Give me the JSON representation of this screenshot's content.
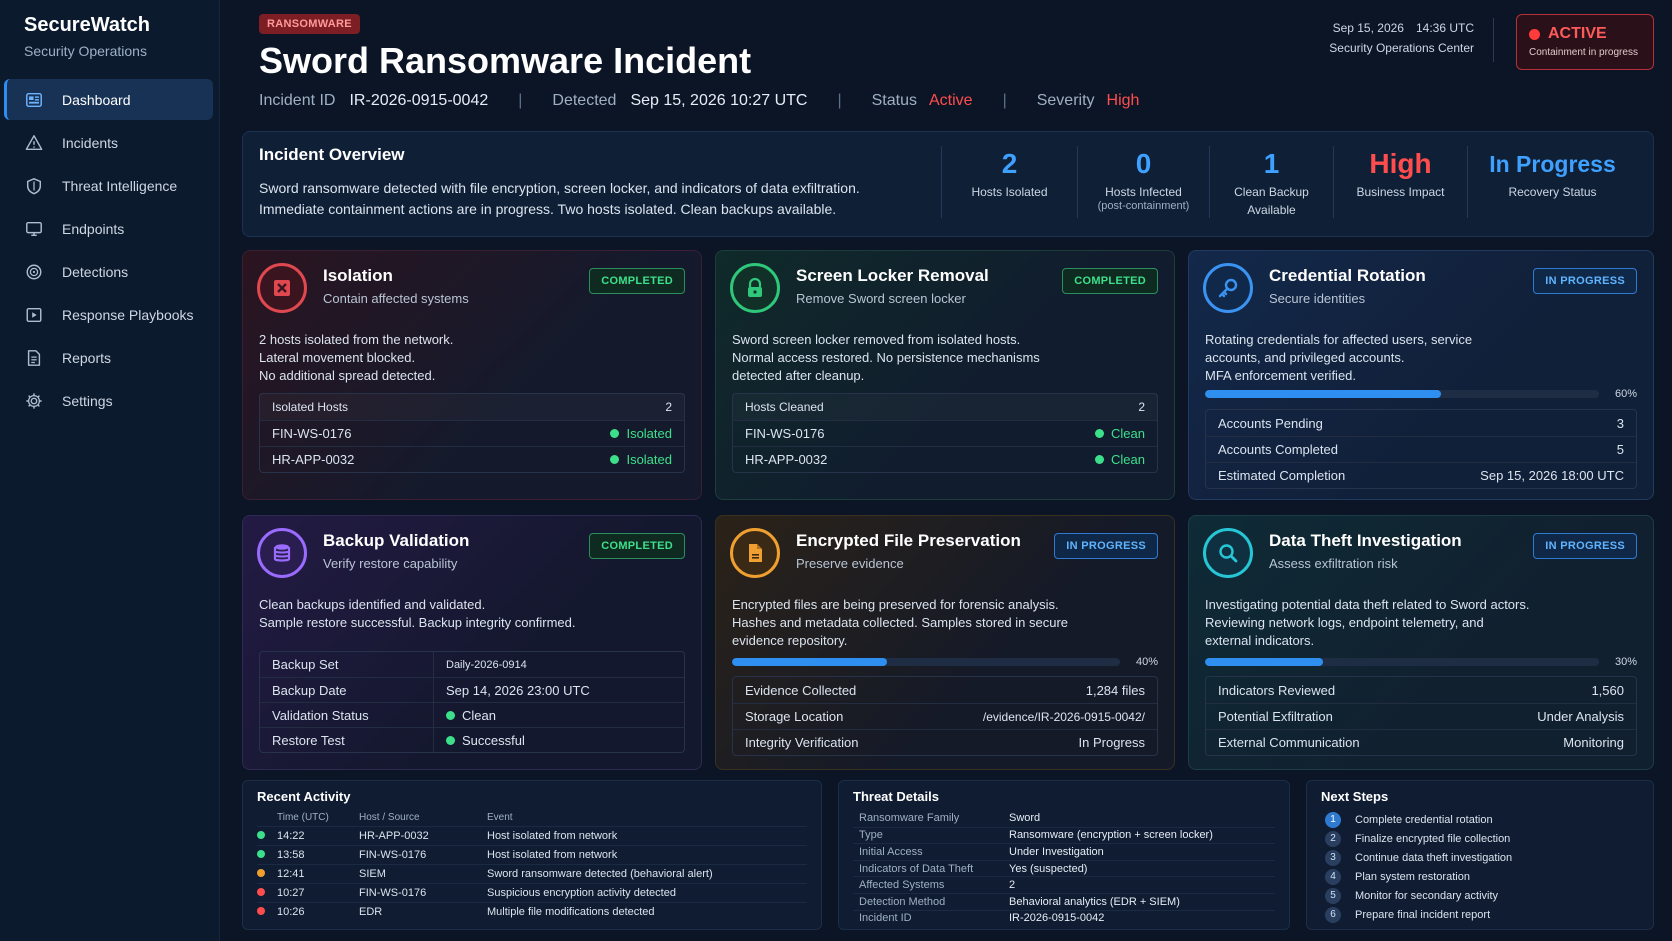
{
  "brand": {
    "title": "SecureWatch",
    "subtitle": "Security Operations"
  },
  "sidebar": {
    "items": [
      {
        "label": "Dashboard",
        "icon": "dashboard-icon",
        "active": true
      },
      {
        "label": "Incidents",
        "icon": "warning-triangle-icon"
      },
      {
        "label": "Threat Intelligence",
        "icon": "shield-icon"
      },
      {
        "label": "Endpoints",
        "icon": "monitor-icon"
      },
      {
        "label": "Detections",
        "icon": "radar-icon"
      },
      {
        "label": "Response Playbooks",
        "icon": "playbook-icon"
      },
      {
        "label": "Reports",
        "icon": "document-icon"
      },
      {
        "label": "Settings",
        "icon": "gear-icon"
      }
    ]
  },
  "header": {
    "tag": "RANSOMWARE",
    "title": "Sword Ransomware Incident",
    "incident_label": "Incident ID",
    "incident_id": "IR-2026-0915-0042",
    "detected_label": "Detected",
    "detected_value": "Sep 15, 2026 10:27 UTC",
    "status_label": "Status",
    "status_value": "Active",
    "severity_label": "Severity",
    "severity_value": "High",
    "date": "Sep 15, 2026",
    "time": "14:36 UTC",
    "center": "Security Operations Center",
    "active_label": "ACTIVE",
    "active_sub": "Containment in progress"
  },
  "colors": {
    "accent": "#2f8cf0",
    "danger": "#ff4d4d",
    "success": "#3de08a"
  },
  "overview": {
    "title": "Incident Overview",
    "description": "Sword ransomware detected with file encryption, screen locker, and indicators of data exfiltration. Immediate containment actions are in progress. Two hosts isolated. Clean backups available.",
    "stats": [
      {
        "value": "2",
        "label": "Hosts Isolated",
        "sub": ""
      },
      {
        "value": "0",
        "label": "Hosts Infected",
        "sub": "(post-containment)"
      },
      {
        "value": "1",
        "label": "Clean Backup",
        "sub": "Available"
      },
      {
        "value": "High",
        "label": "Business Impact",
        "sub": ""
      },
      {
        "value": "In Progress",
        "label": "Recovery Status",
        "sub": ""
      }
    ]
  },
  "cards": {
    "isolation": {
      "title": "Isolation",
      "subtitle": "Contain affected systems",
      "badge": "COMPLETED",
      "desc": [
        "2 hosts isolated from the network.",
        "Lateral movement blocked.",
        "No additional spread detected."
      ],
      "table_head": "Isolated Hosts",
      "table_count": "2",
      "rows": [
        {
          "host": "FIN-WS-0176",
          "status": "Isolated"
        },
        {
          "host": "HR-APP-0032",
          "status": "Isolated"
        }
      ]
    },
    "screen": {
      "title": "Screen Locker Removal",
      "subtitle": "Remove Sword screen locker",
      "badge": "COMPLETED",
      "desc": [
        "Sword screen locker removed from isolated hosts.",
        "Normal access restored. No persistence mechanisms",
        "detected after cleanup."
      ],
      "table_head": "Hosts Cleaned",
      "table_count": "2",
      "rows": [
        {
          "host": "FIN-WS-0176",
          "status": "Clean"
        },
        {
          "host": "HR-APP-0032",
          "status": "Clean"
        }
      ]
    },
    "credential": {
      "title": "Credential Rotation",
      "subtitle": "Secure identities",
      "badge": "IN PROGRESS",
      "desc": [
        "Rotating credentials for affected users, service",
        "accounts, and privileged accounts.",
        "MFA enforcement verified."
      ],
      "progress": 60,
      "progress_label": "60%",
      "rows": [
        {
          "k": "Accounts Pending",
          "v": "3"
        },
        {
          "k": "Accounts Completed",
          "v": "5"
        },
        {
          "k": "Estimated Completion",
          "v": "Sep 15, 2026 18:00 UTC"
        }
      ]
    },
    "backup": {
      "title": "Backup Validation",
      "subtitle": "Verify restore capability",
      "badge": "COMPLETED",
      "desc": [
        "Clean backups identified and validated.",
        "Sample restore successful. Backup integrity confirmed."
      ],
      "rows": [
        {
          "k": "Backup Set",
          "v": "Daily-2026-0914"
        },
        {
          "k": "Backup Date",
          "v": "Sep 14, 2026 23:00 UTC"
        },
        {
          "k": "Validation Status",
          "v": "Clean"
        },
        {
          "k": "Restore Test",
          "v": "Successful"
        }
      ]
    },
    "encrypted": {
      "title": "Encrypted File Preservation",
      "subtitle": "Preserve evidence",
      "badge": "IN PROGRESS",
      "desc": [
        "Encrypted files are being preserved for forensic analysis.",
        "Hashes and metadata collected. Samples stored in secure",
        "evidence repository."
      ],
      "progress": 40,
      "progress_label": "40%",
      "rows": [
        {
          "k": "Evidence Collected",
          "v": "1,284 files"
        },
        {
          "k": "Storage Location",
          "v": "/evidence/IR-2026-0915-0042/"
        },
        {
          "k": "Integrity Verification",
          "v": "In Progress"
        }
      ]
    },
    "theft": {
      "title": "Data Theft Investigation",
      "subtitle": "Assess exfiltration risk",
      "badge": "IN PROGRESS",
      "desc": [
        "Investigating potential data theft related to Sword actors.",
        "Reviewing network logs, endpoint telemetry, and",
        "external indicators."
      ],
      "progress": 30,
      "progress_label": "30%",
      "rows": [
        {
          "k": "Indicators Reviewed",
          "v": "1,560"
        },
        {
          "k": "Potential Exfiltration",
          "v": "Under Analysis"
        },
        {
          "k": "External Communication",
          "v": "Monitoring"
        }
      ]
    }
  },
  "activity": {
    "title": "Recent Activity",
    "headers": [
      "Time (UTC)",
      "Host / Source",
      "Event"
    ],
    "rows": [
      {
        "time": "14:22",
        "host": "HR-APP-0032",
        "event": "Host isolated from network",
        "color": "#3de08a"
      },
      {
        "time": "13:58",
        "host": "FIN-WS-0176",
        "event": "Host isolated from network",
        "color": "#3de08a"
      },
      {
        "time": "12:41",
        "host": "SIEM",
        "event": "Sword ransomware detected (behavioral alert)",
        "color": "#f0a030"
      },
      {
        "time": "10:27",
        "host": "FIN-WS-0176",
        "event": "Suspicious encryption activity detected",
        "color": "#ff4d4d"
      },
      {
        "time": "10:26",
        "host": "EDR",
        "event": "Multiple file modifications detected",
        "color": "#ff4d4d"
      }
    ]
  },
  "threat": {
    "title": "Threat Details",
    "rows": [
      {
        "k": "Ransomware Family",
        "v": "Sword"
      },
      {
        "k": "Type",
        "v": "Ransomware (encryption + screen locker)"
      },
      {
        "k": "Initial Access",
        "v": "Under Investigation"
      },
      {
        "k": "Indicators of Data Theft",
        "v": "Yes (suspected)"
      },
      {
        "k": "Affected Systems",
        "v": "2"
      },
      {
        "k": "Detection Method",
        "v": "Behavioral analytics (EDR + SIEM)"
      },
      {
        "k": "Incident ID",
        "v": "IR-2026-0915-0042"
      }
    ]
  },
  "next_steps": {
    "title": "Next Steps",
    "items": [
      "Complete credential rotation",
      "Finalize encrypted file collection",
      "Continue data theft investigation",
      "Plan system restoration",
      "Monitor for secondary activity",
      "Prepare final incident report"
    ]
  }
}
